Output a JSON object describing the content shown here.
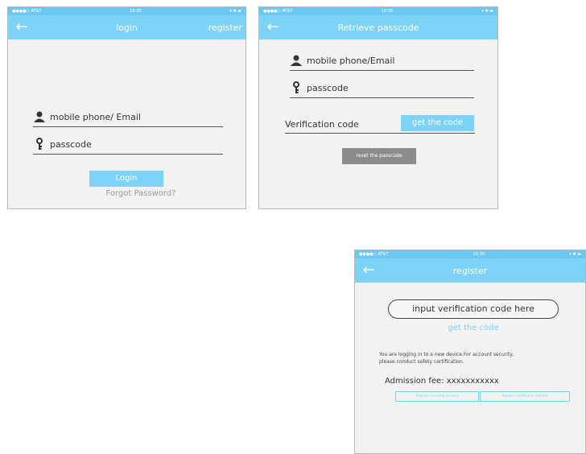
{
  "status": {
    "carrier": "●●●●○  AT&T",
    "time": "10:30",
    "battery": "▾ ✱ ▬"
  },
  "login": {
    "title": "login",
    "register_link": "register",
    "username_placeholder": "mobile phone/ Email",
    "passcode_placeholder": "passcode",
    "login_button": "Login",
    "forgot_link": "Forgot Password?"
  },
  "retrieve": {
    "title": "Retrieve passcode",
    "username_placeholder": "mobile phone/Email",
    "passcode_placeholder": "passcode",
    "verification_label": "Verification code",
    "get_code_button": "get the code",
    "reset_button": "reset the passcode"
  },
  "register": {
    "title": "register",
    "verification_input": "input verification code here",
    "get_code_link": "get the code",
    "notice_line1": "You are logging in to a new device.For account security,",
    "notice_line2": "please conduct safety certification.",
    "admission_label": "Admission fee: xxxxxxxxxxx",
    "replace_account_button": "Replace receiving account",
    "replace_method_button": "Replace verification method"
  },
  "colors": {
    "accent": "#7dd3f7",
    "status_bar": "#6cc8f0",
    "background": "#f2f2f2",
    "gray_button": "#8c8c8c"
  }
}
